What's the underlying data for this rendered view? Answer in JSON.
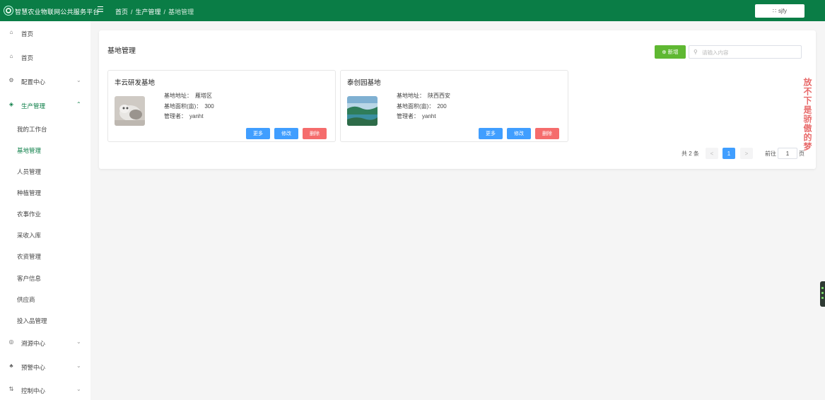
{
  "header": {
    "app_title": "智慧农业物联网公共服务平台",
    "breadcrumb": [
      "首页",
      "生产管理",
      "基地管理"
    ],
    "breadcrumb_sep": "/",
    "user_name": "sjfy",
    "user_icon": "grid-icon"
  },
  "sidebar": {
    "items": [
      {
        "label": "首页",
        "icon": "home-icon"
      },
      {
        "label": "首页",
        "icon": "home-icon"
      },
      {
        "label": "配置中心",
        "icon": "gear-icon",
        "arrow": "⌄"
      },
      {
        "label": "生产管理",
        "icon": "layers-icon",
        "arrow": "⌃"
      }
    ],
    "sub_items": [
      "我的工作台",
      "基地管理",
      "人员管理",
      "种植管理",
      "农事作业",
      "采收入库",
      "农资管理",
      "客户信息",
      "供应商",
      "投入品管理"
    ],
    "bottom_items": [
      {
        "label": "溯源中心",
        "icon": "target-icon",
        "arrow": "⌄"
      },
      {
        "label": "预警中心",
        "icon": "bell-icon",
        "arrow": "⌄"
      },
      {
        "label": "控制中心",
        "icon": "sliders-icon",
        "arrow": "⌄"
      }
    ],
    "active_sub": "基地管理",
    "active_color": "#0a7d46"
  },
  "main": {
    "title": "基地管理",
    "add_label": "新增",
    "search_placeholder": "请输入内容",
    "field_labels": {
      "address": "基地地址：",
      "area": "基地面积(亩)：",
      "manager": "管理者："
    },
    "buttons": {
      "more": "更多",
      "edit": "修改",
      "delete": "删除"
    },
    "bases": [
      {
        "name": "丰云研发基地",
        "address": "雁塔区",
        "area": "300",
        "manager": "yanht",
        "thumb": "cat-photo"
      },
      {
        "name": "泰创园基地",
        "address": "陕西西安",
        "area": "200",
        "manager": "yanht",
        "thumb": "lake-photo"
      }
    ],
    "pagination": {
      "total": "共 2 条",
      "prev": "<",
      "current": "1",
      "next": ">",
      "goto_prefix": "前往",
      "goto_value": "1",
      "goto_suffix": "页"
    }
  },
  "overlay_text": "放不下是骄傲的梦",
  "colors": {
    "header": "#0a7d46",
    "add_button": "#5fb832",
    "primary": "#409eff",
    "danger": "#f56c6c"
  }
}
